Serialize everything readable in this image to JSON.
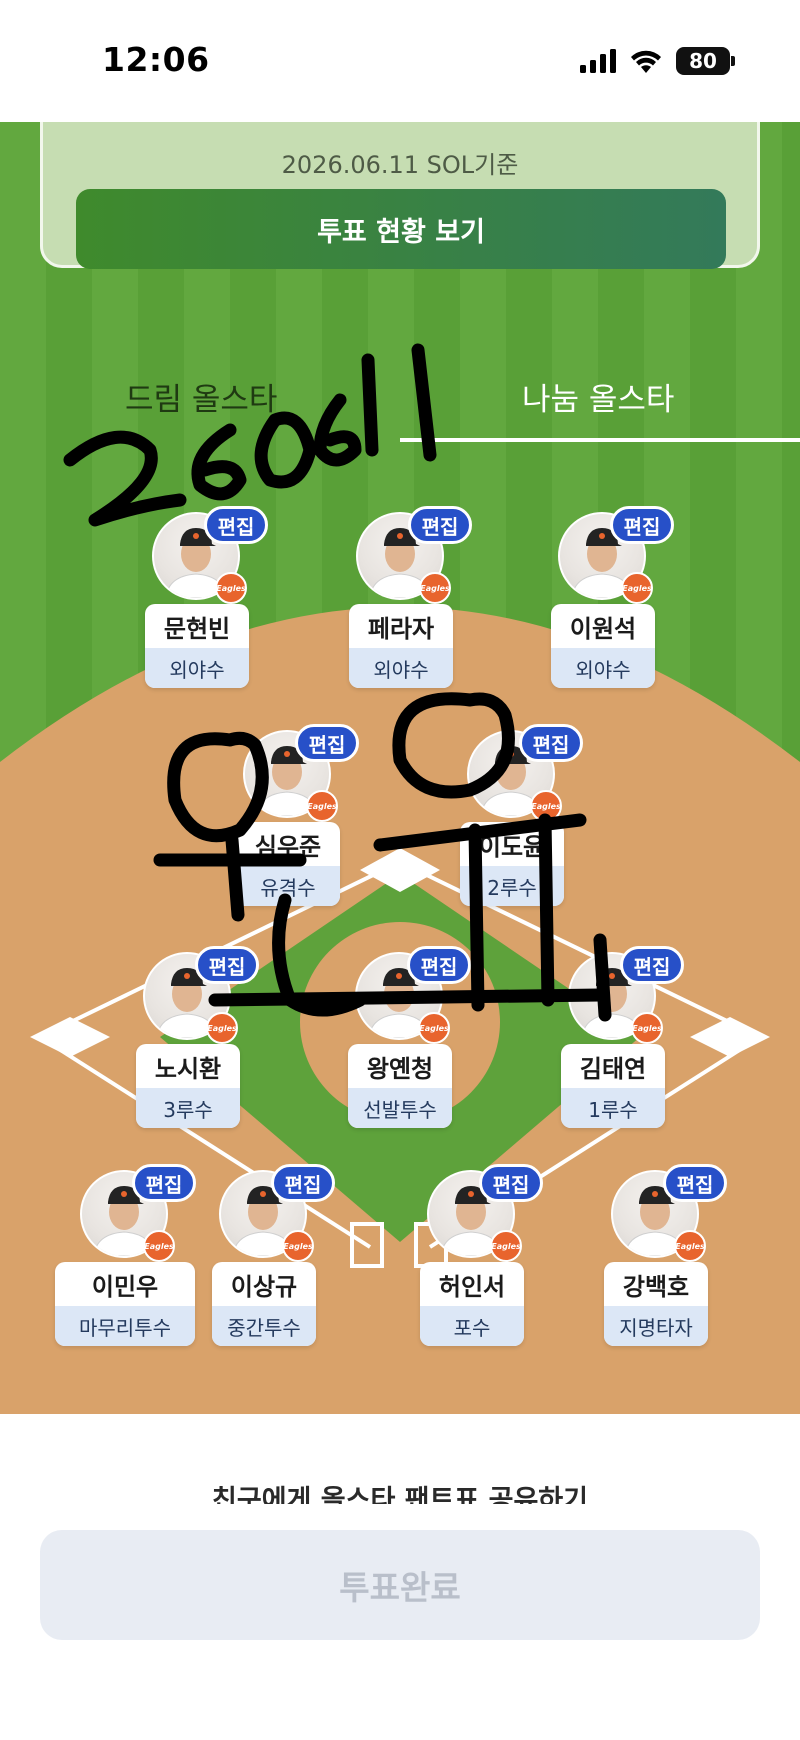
{
  "status_bar": {
    "time": "12:06",
    "battery": "80"
  },
  "header": {
    "date_text": "2026.06.11 SOL기준",
    "vote_status_button": "투표 현황 보기"
  },
  "tabs": [
    {
      "label": "드림 올스타",
      "selected": false
    },
    {
      "label": "나눔 올스타",
      "selected": true
    }
  ],
  "edit_label": "편집",
  "team_logo_text": "Eagles",
  "players": [
    {
      "name": "문현빈",
      "position": "외야수"
    },
    {
      "name": "페라자",
      "position": "외야수"
    },
    {
      "name": "이원석",
      "position": "외야수"
    },
    {
      "name": "심우준",
      "position": "유격수"
    },
    {
      "name": "이도윤",
      "position": "2루수"
    },
    {
      "name": "노시환",
      "position": "3루수"
    },
    {
      "name": "왕옌청",
      "position": "선발투수"
    },
    {
      "name": "김태연",
      "position": "1루수"
    },
    {
      "name": "이민우",
      "position": "마무리투수"
    },
    {
      "name": "이상규",
      "position": "중간투수"
    },
    {
      "name": "허인서",
      "position": "포수"
    },
    {
      "name": "강백호",
      "position": "지명타자"
    }
  ],
  "handwriting": {
    "text": "260611 오유"
  },
  "footer": {
    "share_text": "친구에게 올스타 팬트표 공유하기",
    "done_button": "투표완료"
  },
  "colors": {
    "edit_badge": "#2750c8",
    "vote_button": "#3f8a2c",
    "field_green": "#62a83f",
    "infield_dirt": "#d9a26a"
  }
}
